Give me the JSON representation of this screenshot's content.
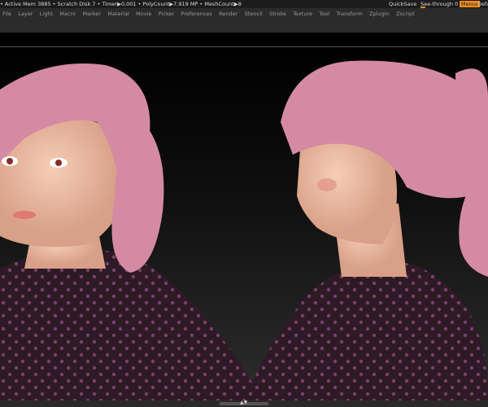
{
  "status": {
    "text": "• Active Mem 3885 • Scratch Disk 7 • Timer▶0.001 • PolyCount▶7.919 MP • MeshCount▶8",
    "quicksave": "QuickSave",
    "see_through": "See-through  0",
    "menus": "Menus",
    "default": "Defa"
  },
  "menu": [
    "File",
    "Layer",
    "Light",
    "Macro",
    "Marker",
    "Material",
    "Movie",
    "Picker",
    "Preferences",
    "Render",
    "Stencil",
    "Stroke",
    "Texture",
    "Tool",
    "Transform",
    "Zplugin",
    "Zscript"
  ],
  "colors": {
    "accent": "#f08a1c",
    "hair": "#d48aa2",
    "skin": "#f0c0a8",
    "shirt": "#2e1a26",
    "dots": "#8a4a78"
  },
  "bottom": {
    "arrows": "▲▼"
  }
}
